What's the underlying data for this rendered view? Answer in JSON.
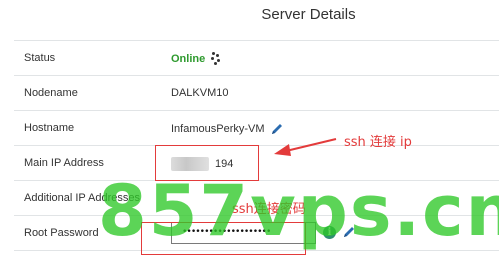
{
  "header": {
    "title": "Server Details"
  },
  "details": {
    "rows": [
      {
        "label": "Status",
        "value": "Online"
      },
      {
        "label": "Nodename",
        "value": "DALKVM10"
      },
      {
        "label": "Hostname",
        "value": "InfamousPerky-VM"
      },
      {
        "label": "Main IP Address",
        "value": "194"
      },
      {
        "label": "Additional IP Addresses",
        "value": ""
      },
      {
        "label": "Root Password",
        "value": "••••••••••••••••••••"
      }
    ]
  },
  "annotations": {
    "ssh_ip": "ssh 连接 ip",
    "ssh_password": "ssh连接密码"
  },
  "watermark": {
    "text": "857vps.cn",
    "color": "#2ec828"
  },
  "icons": {
    "status": "spinner-icon",
    "hostname_edit": "pencil-icon",
    "password_info": "info-icon",
    "password_edit": "pencil-icon"
  },
  "colors": {
    "online": "#2e9a2e",
    "annotation": "#e33b3b",
    "edit_icon": "#2b6cb0"
  }
}
